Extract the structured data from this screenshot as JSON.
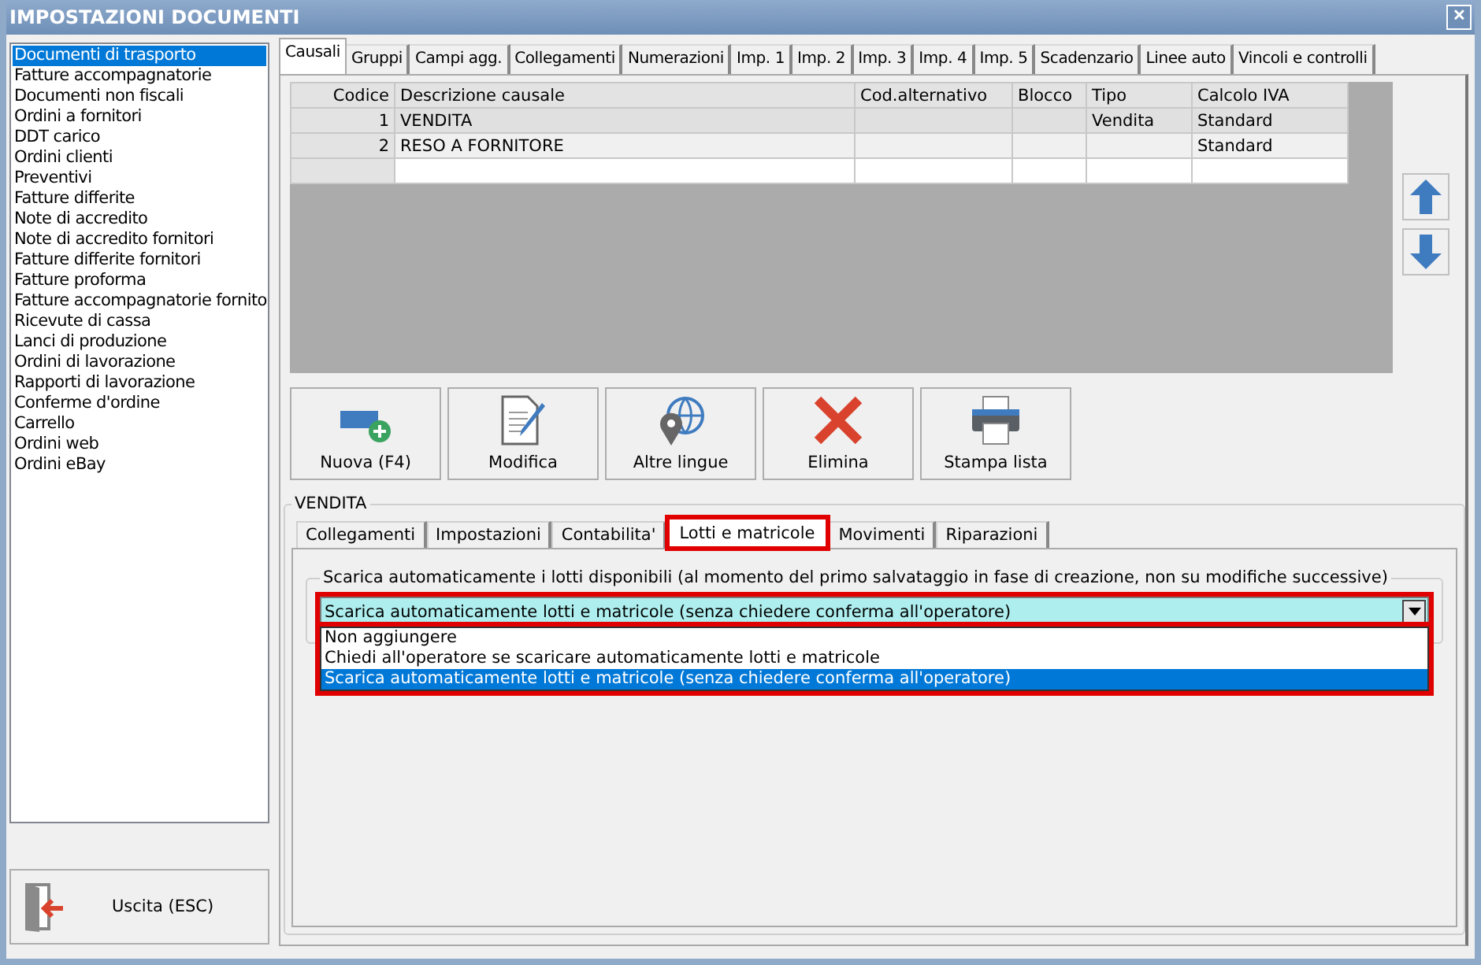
{
  "window": {
    "title": "IMPOSTAZIONI DOCUMENTI",
    "close": "✕"
  },
  "sidebar": {
    "items": [
      {
        "label": "Documenti di trasporto",
        "selected": true
      },
      {
        "label": "Fatture accompagnatorie",
        "selected": false
      },
      {
        "label": "Documenti non fiscali",
        "selected": false
      },
      {
        "label": "Ordini a fornitori",
        "selected": false
      },
      {
        "label": "DDT carico",
        "selected": false
      },
      {
        "label": "Ordini clienti",
        "selected": false
      },
      {
        "label": "Preventivi",
        "selected": false
      },
      {
        "label": "Fatture differite",
        "selected": false
      },
      {
        "label": "Note di accredito",
        "selected": false
      },
      {
        "label": "Note di accredito fornitori",
        "selected": false
      },
      {
        "label": "Fatture differite fornitori",
        "selected": false
      },
      {
        "label": "Fatture proforma",
        "selected": false
      },
      {
        "label": "Fatture accompagnatorie fornito",
        "selected": false
      },
      {
        "label": "Ricevute di cassa",
        "selected": false
      },
      {
        "label": "Lanci di produzione",
        "selected": false
      },
      {
        "label": "Ordini di lavorazione",
        "selected": false
      },
      {
        "label": "Rapporti di lavorazione",
        "selected": false
      },
      {
        "label": "Conferme d'ordine",
        "selected": false
      },
      {
        "label": "Carrello",
        "selected": false
      },
      {
        "label": "Ordini web",
        "selected": false
      },
      {
        "label": "Ordini eBay",
        "selected": false
      }
    ],
    "exit_button": "Uscita (ESC)"
  },
  "tabs": [
    {
      "label": "Causali",
      "selected": true
    },
    {
      "label": "Gruppi",
      "selected": false
    },
    {
      "label": "Campi agg.",
      "selected": false
    },
    {
      "label": "Collegamenti",
      "selected": false
    },
    {
      "label": "Numerazioni",
      "selected": false
    },
    {
      "label": "Imp. 1",
      "selected": false
    },
    {
      "label": "Imp. 2",
      "selected": false
    },
    {
      "label": "Imp. 3",
      "selected": false
    },
    {
      "label": "Imp. 4",
      "selected": false
    },
    {
      "label": "Imp. 5",
      "selected": false
    },
    {
      "label": "Scadenzario",
      "selected": false
    },
    {
      "label": "Linee auto",
      "selected": false
    },
    {
      "label": "Vincoli e controlli",
      "selected": false
    }
  ],
  "table": {
    "columns": [
      "Codice",
      "Descrizione causale",
      "Cod.alternativo",
      "Blocco",
      "Tipo",
      "Calcolo IVA"
    ],
    "rows": [
      {
        "selected": true,
        "cells": [
          "1",
          "VENDITA",
          "",
          "",
          "Vendita",
          "Standard"
        ]
      },
      {
        "selected": false,
        "cells": [
          "2",
          "RESO A FORNITORE",
          "",
          "",
          "",
          "Standard"
        ]
      }
    ]
  },
  "buttons": [
    {
      "kind": "new",
      "label": "Nuova (F4)"
    },
    {
      "kind": "edit",
      "label": "Modifica"
    },
    {
      "kind": "globe",
      "label": "Altre lingue"
    },
    {
      "kind": "delete",
      "label": "Elimina"
    },
    {
      "kind": "print",
      "label": "Stampa lista"
    }
  ],
  "detail": {
    "legend": "VENDITA",
    "subtabs": [
      {
        "label": "Collegamenti",
        "selected": false,
        "highlighted": false
      },
      {
        "label": "Impostazioni",
        "selected": false,
        "highlighted": false
      },
      {
        "label": "Contabilita'",
        "selected": false,
        "highlighted": false
      },
      {
        "label": "Lotti e matricole",
        "selected": true,
        "highlighted": true
      },
      {
        "label": "Movimenti",
        "selected": false,
        "highlighted": false
      },
      {
        "label": "Riparazioni",
        "selected": false,
        "highlighted": false
      }
    ],
    "group_label": "Scarica automaticamente i lotti disponibili (al momento del primo salvataggio in fase di creazione, non su modifiche successive)",
    "dropdown": {
      "value": "Scarica automaticamente lotti e matricole (senza chiedere conferma all'operatore)",
      "expanded": true,
      "highlighted": true,
      "options": [
        {
          "label": "Non aggiungere",
          "selected": false
        },
        {
          "label": "Chiedi all'operatore se scaricare automaticamente lotti e matricole",
          "selected": false
        },
        {
          "label": "Scarica automaticamente lotti e matricole (senza chiedere conferma all'operatore)",
          "selected": true
        }
      ]
    }
  }
}
